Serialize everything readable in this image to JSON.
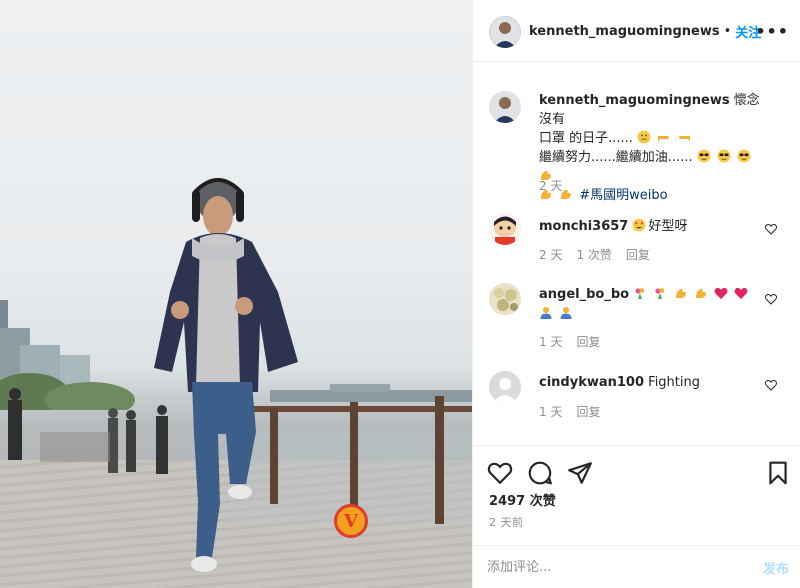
{
  "post": {
    "username": "kenneth_maguomingnews",
    "follow_label": "关注",
    "more_label": "•••",
    "caption_line1": "懷念沒有",
    "caption_line2": "口罩 的日子......",
    "caption_line3": "繼續努力......繼續加油......",
    "hashtag": "#馬國明weibo",
    "caption_time": "2 天",
    "likes": "2497 次赞",
    "posted_ago": "2 天前",
    "comment_placeholder": "添加评论...",
    "post_label": "发布"
  },
  "comments": [
    {
      "username": "monchi3657",
      "text": "好型呀",
      "time": "2 天",
      "likes": "1 次赞",
      "reply": "回复",
      "emojis": [
        "heart-eyes"
      ]
    },
    {
      "username": "angel_bo_bo",
      "text": "",
      "time": "1 天",
      "reply": "回复",
      "emojis": [
        "bouquet",
        "bouquet",
        "muscle",
        "muscle",
        "heart",
        "heart",
        "person",
        "person"
      ]
    },
    {
      "username": "cindykwan100",
      "text": "Fighting",
      "time": "1 天",
      "reply": "回复",
      "emojis": []
    }
  ],
  "photo": {
    "logo_letter": "V"
  },
  "colors": {
    "link_blue": "#0095f6",
    "muted": "#8e8e8e",
    "hashtag": "#00376b",
    "post_disabled": "#b2dffc"
  }
}
